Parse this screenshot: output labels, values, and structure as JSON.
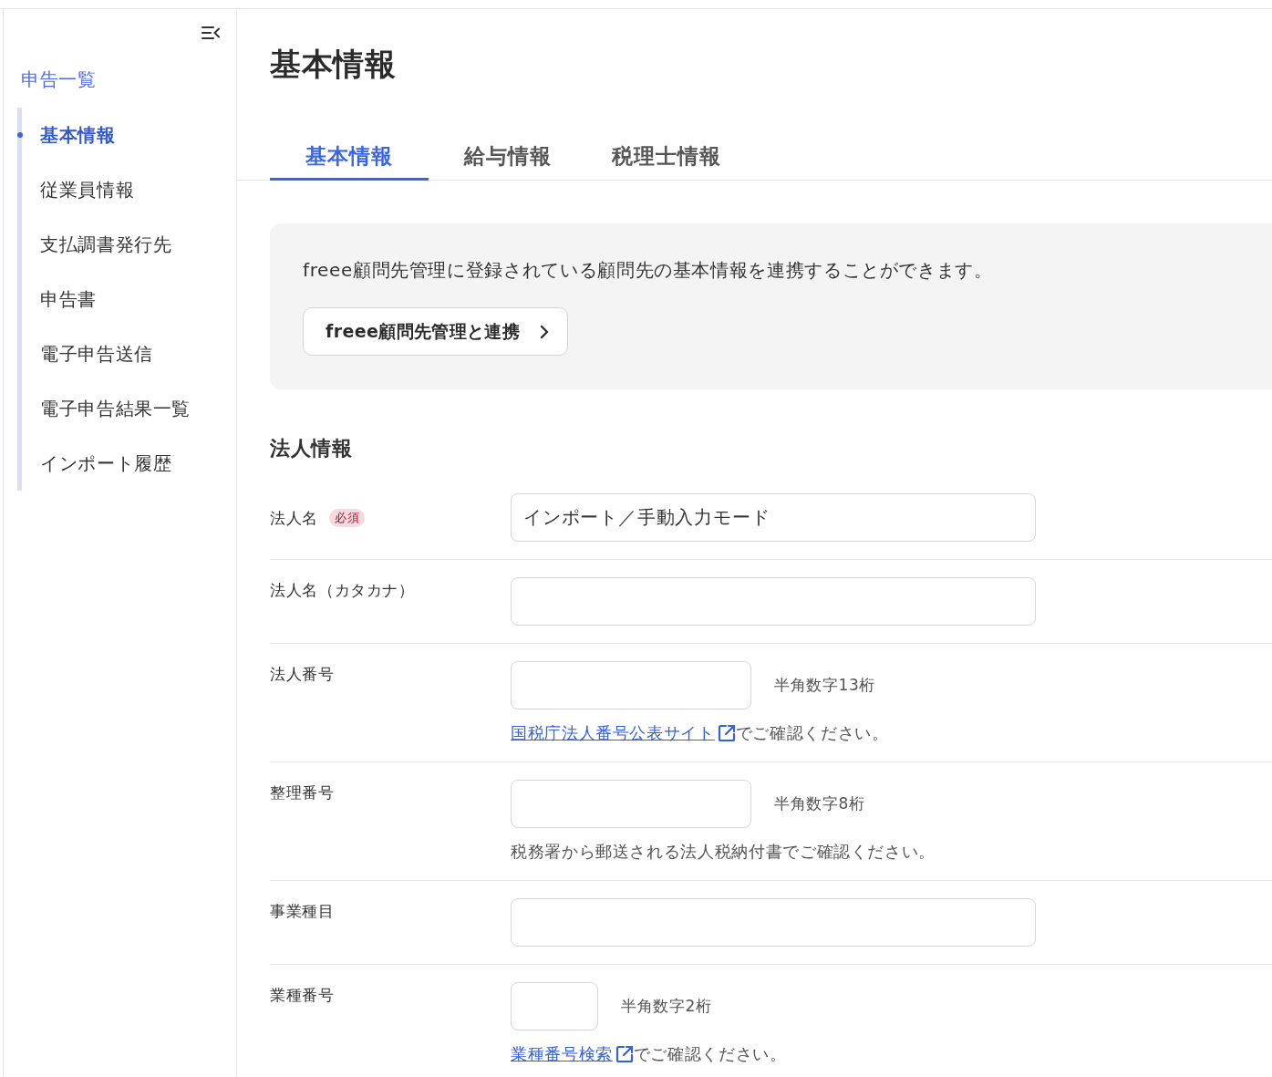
{
  "sidebar": {
    "back_link": "申告一覧",
    "items": [
      {
        "label": "基本情報",
        "selected": true
      },
      {
        "label": "従業員情報",
        "selected": false
      },
      {
        "label": "支払調書発行先",
        "selected": false
      },
      {
        "label": "申告書",
        "selected": false
      },
      {
        "label": "電子申告送信",
        "selected": false
      },
      {
        "label": "電子申告結果一覧",
        "selected": false
      },
      {
        "label": "インポート履歴",
        "selected": false
      }
    ]
  },
  "page_title": "基本情報",
  "tabs": [
    {
      "label": "基本情報",
      "selected": true
    },
    {
      "label": "給与情報",
      "selected": false
    },
    {
      "label": "税理士情報",
      "selected": false
    }
  ],
  "info_box": {
    "text": "freee顧問先管理に登録されている顧問先の基本情報を連携することができます。",
    "button": "freee顧問先管理と連携"
  },
  "section": {
    "title": "法人情報",
    "fields": [
      {
        "label": "法人名",
        "badge": "必須",
        "kind": "wide",
        "value": "インポート／手動入力モード"
      },
      {
        "label": "法人名（カタカナ）",
        "kind": "wide"
      },
      {
        "label": "法人番号",
        "kind": "medium",
        "hint": "半角数字13桁",
        "note": {
          "link": "国税庁法人番号公表サイト",
          "text": "でご確認ください。"
        }
      },
      {
        "label": "整理番号",
        "kind": "medium",
        "hint": "半角数字8桁",
        "note": {
          "text": "税務署から郵送される法人税納付書でご確認ください。"
        }
      },
      {
        "label": "事業種目",
        "kind": "wide"
      },
      {
        "label": "業種番号",
        "kind": "short",
        "hint": "半角数字2桁",
        "note": {
          "link": "業種番号検索",
          "text": "でご確認ください。"
        }
      }
    ]
  }
}
